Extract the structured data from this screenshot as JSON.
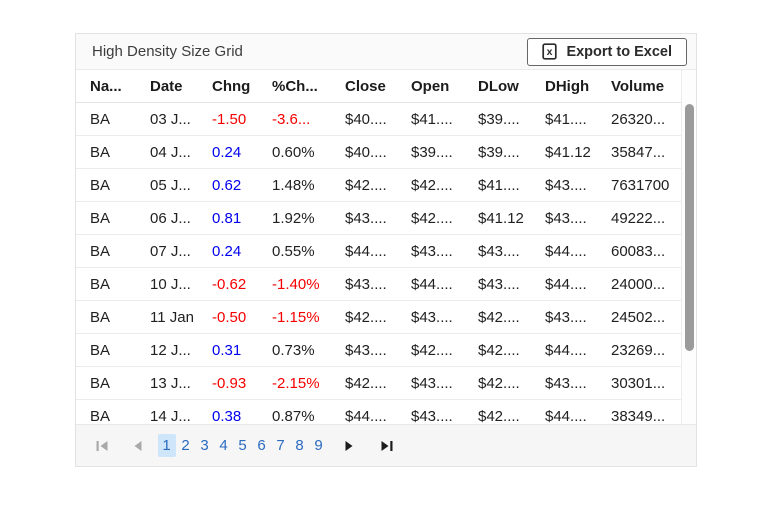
{
  "colors": {
    "negative": "#f50000",
    "positive": "#0000ee",
    "pager_link": "#2a6bc0",
    "pager_current_bg": "#cfe5fa"
  },
  "panel": {
    "title": "High Density Size Grid",
    "export_button_label": "Export to Excel",
    "export_button_icon": "excel-file-icon"
  },
  "table": {
    "columns": [
      {
        "key": "name",
        "label": "Na..."
      },
      {
        "key": "date",
        "label": "Date"
      },
      {
        "key": "chng",
        "label": "Chng"
      },
      {
        "key": "pct_chng",
        "label": "%Ch..."
      },
      {
        "key": "close",
        "label": "Close"
      },
      {
        "key": "open",
        "label": "Open"
      },
      {
        "key": "dlow",
        "label": "DLow"
      },
      {
        "key": "dhigh",
        "label": "DHigh"
      },
      {
        "key": "volume",
        "label": "Volume"
      }
    ],
    "rows": [
      {
        "name": "BA",
        "date": "03 J...",
        "chng": "-1.50",
        "pct_chng": "-3.6...",
        "close": "$40....",
        "open": "$41....",
        "dlow": "$39....",
        "dhigh": "$41....",
        "volume": "26320..."
      },
      {
        "name": "BA",
        "date": "04 J...",
        "chng": "0.24",
        "pct_chng": "0.60%",
        "close": "$40....",
        "open": "$39....",
        "dlow": "$39....",
        "dhigh": "$41.12",
        "volume": "35847..."
      },
      {
        "name": "BA",
        "date": "05 J...",
        "chng": "0.62",
        "pct_chng": "1.48%",
        "close": "$42....",
        "open": "$42....",
        "dlow": "$41....",
        "dhigh": "$43....",
        "volume": "7631700"
      },
      {
        "name": "BA",
        "date": "06 J...",
        "chng": "0.81",
        "pct_chng": "1.92%",
        "close": "$43....",
        "open": "$42....",
        "dlow": "$41.12",
        "dhigh": "$43....",
        "volume": "49222..."
      },
      {
        "name": "BA",
        "date": "07 J...",
        "chng": "0.24",
        "pct_chng": "0.55%",
        "close": "$44....",
        "open": "$43....",
        "dlow": "$43....",
        "dhigh": "$44....",
        "volume": "60083..."
      },
      {
        "name": "BA",
        "date": "10 J...",
        "chng": "-0.62",
        "pct_chng": "-1.40%",
        "close": "$43....",
        "open": "$44....",
        "dlow": "$43....",
        "dhigh": "$44....",
        "volume": "24000..."
      },
      {
        "name": "BA",
        "date": "11 Jan",
        "chng": "-0.50",
        "pct_chng": "-1.15%",
        "close": "$42....",
        "open": "$43....",
        "dlow": "$42....",
        "dhigh": "$43....",
        "volume": "24502..."
      },
      {
        "name": "BA",
        "date": "12 J...",
        "chng": "0.31",
        "pct_chng": "0.73%",
        "close": "$43....",
        "open": "$42....",
        "dlow": "$42....",
        "dhigh": "$44....",
        "volume": "23269..."
      },
      {
        "name": "BA",
        "date": "13 J...",
        "chng": "-0.93",
        "pct_chng": "-2.15%",
        "close": "$42....",
        "open": "$43....",
        "dlow": "$42....",
        "dhigh": "$43....",
        "volume": "30301..."
      },
      {
        "name": "BA",
        "date": "14 J...",
        "chng": "0.38",
        "pct_chng": "0.87%",
        "close": "$44....",
        "open": "$43....",
        "dlow": "$42....",
        "dhigh": "$44....",
        "volume": "38349..."
      }
    ]
  },
  "pager": {
    "pages": [
      "1",
      "2",
      "3",
      "4",
      "5",
      "6",
      "7",
      "8",
      "9"
    ],
    "current_page": "1",
    "icons": [
      "first-page-icon",
      "previous-page-icon",
      "next-page-icon",
      "last-page-icon"
    ]
  }
}
